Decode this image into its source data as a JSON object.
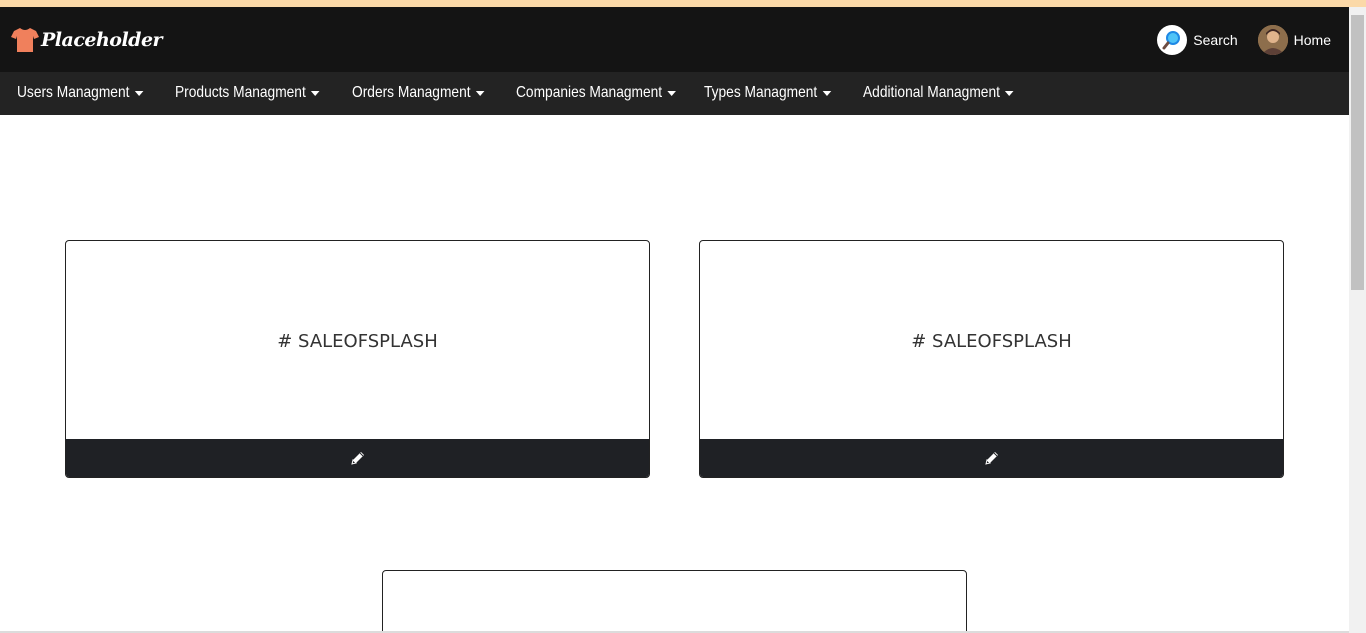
{
  "header": {
    "logo_text": "Placeholder",
    "search_label": "Search",
    "home_label": "Home"
  },
  "menu": {
    "items": [
      {
        "label": "Users Managment"
      },
      {
        "label": "Products Managment"
      },
      {
        "label": "Orders Managment"
      },
      {
        "label": "Companies Managment"
      },
      {
        "label": "Types Managment"
      },
      {
        "label": "Additional Managment"
      }
    ]
  },
  "cards": [
    {
      "title": "# SALEOFSPLASH",
      "action_icon": "pencil-icon"
    },
    {
      "title": "# SALEOFSPLASH",
      "action_icon": "pencil-icon"
    },
    {
      "title": "",
      "action_icon": ""
    }
  ],
  "colors": {
    "top_strip": "#fbd9a8",
    "navbar_bg": "#141414",
    "menubar_bg": "#232323",
    "card_footer_bg": "#1f2125",
    "logo_shirt": "#f0805c"
  }
}
